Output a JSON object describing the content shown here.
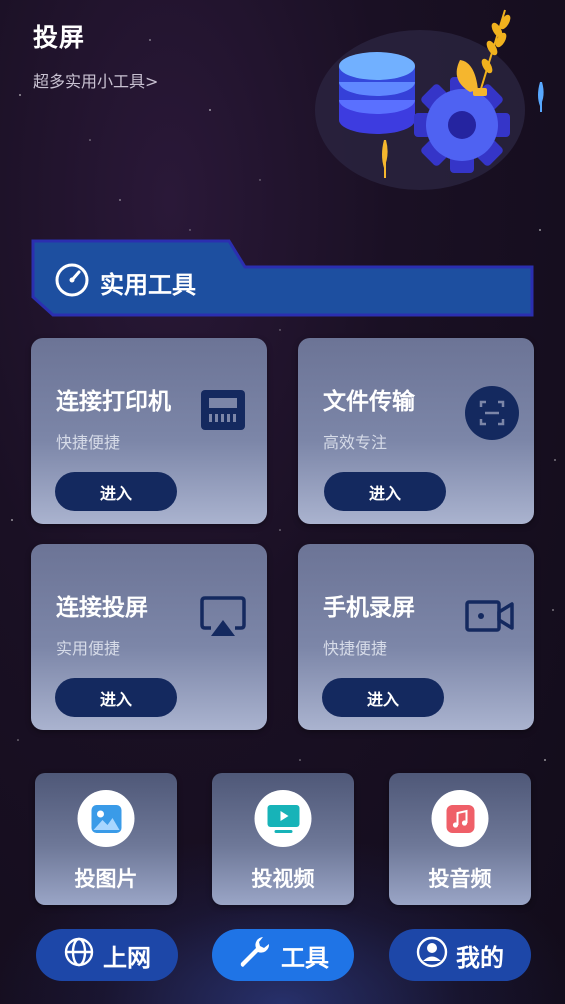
{
  "header": {
    "title": "投屏",
    "subtitle": "超多实用小工具>"
  },
  "section": {
    "title": "实用工具",
    "icon": "gauge-icon"
  },
  "cards": [
    {
      "title": "连接打印机",
      "subtitle": "快捷便捷",
      "button": "进入",
      "icon": "printer-icon"
    },
    {
      "title": "文件传输",
      "subtitle": "高效专注",
      "button": "进入",
      "icon": "scan-icon"
    },
    {
      "title": "连接投屏",
      "subtitle": "实用便捷",
      "button": "进入",
      "icon": "airplay-icon"
    },
    {
      "title": "手机录屏",
      "subtitle": "快捷便捷",
      "button": "进入",
      "icon": "video-camera-icon"
    }
  ],
  "mini_tools": [
    {
      "label": "投图片",
      "icon": "image-icon",
      "color": "#3a9be8"
    },
    {
      "label": "投视频",
      "icon": "video-play-icon",
      "color": "#17b3b8"
    },
    {
      "label": "投音频",
      "icon": "music-icon",
      "color": "#ef5f68"
    }
  ],
  "nav": [
    {
      "label": "上网",
      "icon": "globe-icon",
      "active": false
    },
    {
      "label": "工具",
      "icon": "wrench-icon",
      "active": true
    },
    {
      "label": "我的",
      "icon": "user-icon",
      "active": false
    }
  ],
  "colors": {
    "button_dark": "#14295f",
    "nav_blue": "#1d47a8",
    "nav_active": "#1f74e6",
    "banner": "#1d4fa0"
  }
}
